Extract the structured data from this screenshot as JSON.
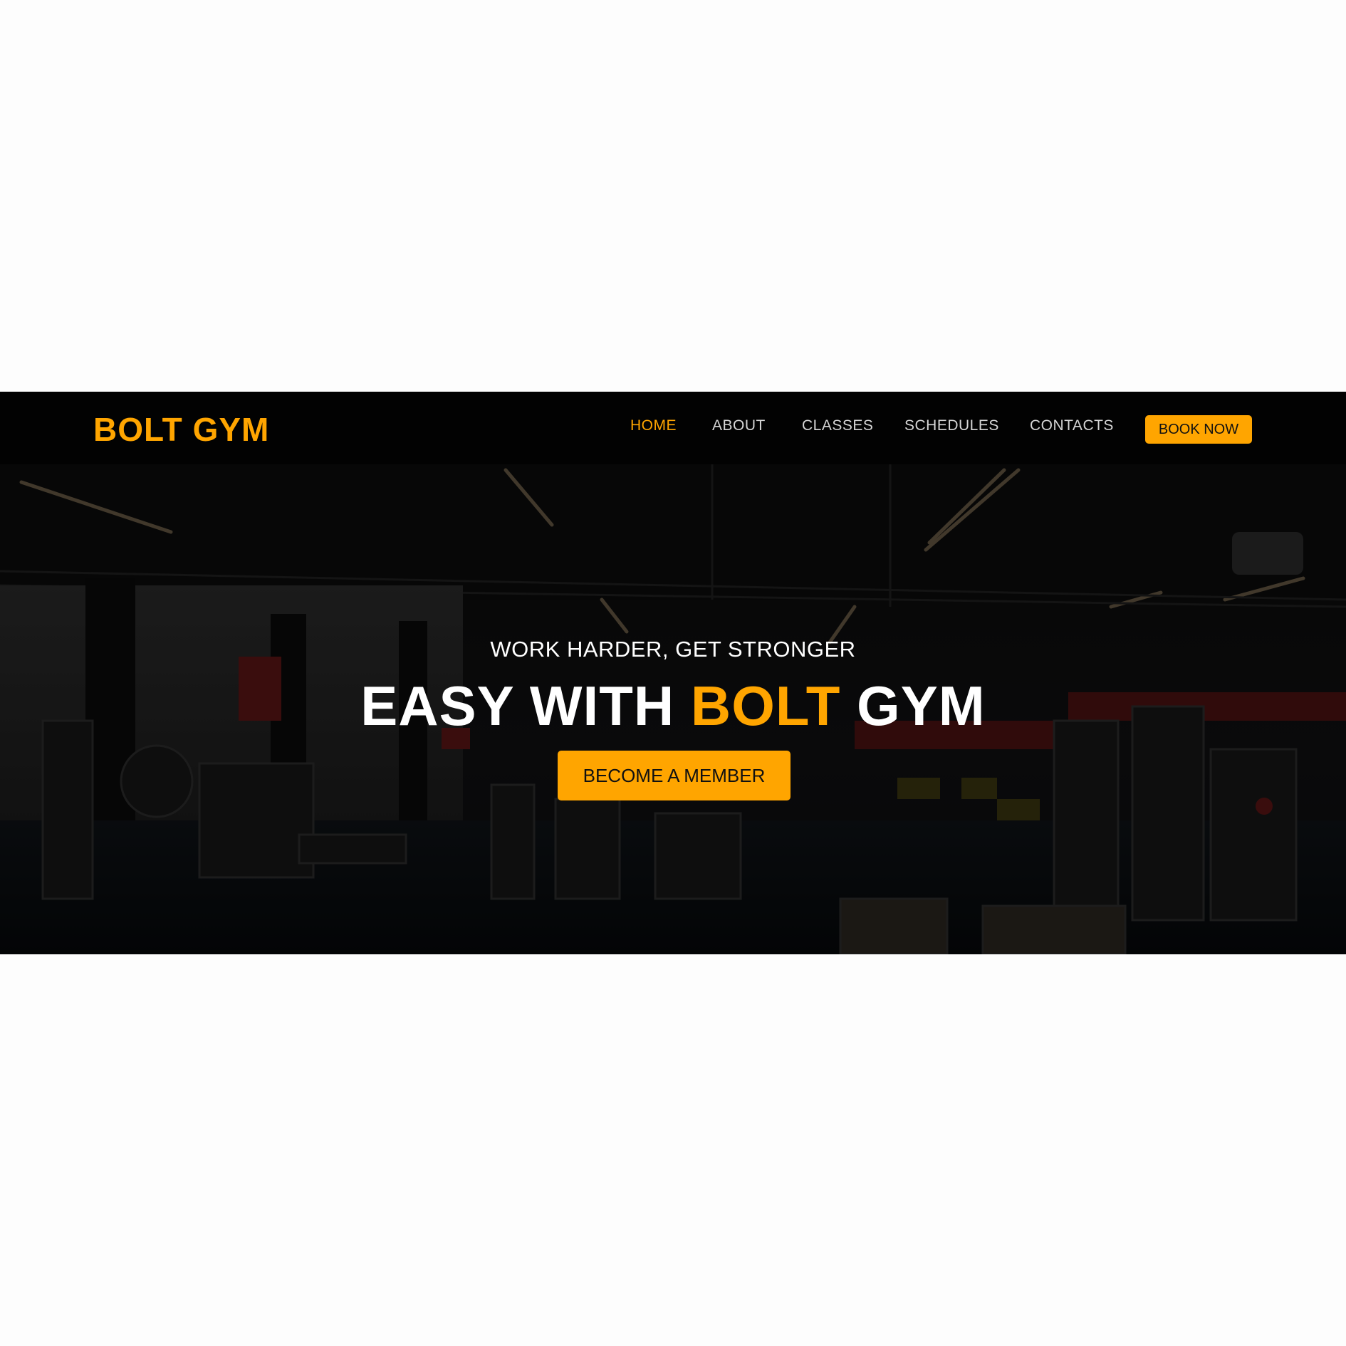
{
  "brand": {
    "name": "BOLT GYM",
    "accent_color": "#ffa500"
  },
  "nav": {
    "items": [
      {
        "label": "HOME",
        "active": true
      },
      {
        "label": "ABOUT",
        "active": false
      },
      {
        "label": "CLASSES",
        "active": false
      },
      {
        "label": "SCHEDULES",
        "active": false
      },
      {
        "label": "CONTACTS",
        "active": false
      }
    ],
    "book_label": "BOOK NOW"
  },
  "hero": {
    "tagline": "WORK HARDER, GET STRONGER",
    "headline_part1": "EASY WITH ",
    "headline_accent": "BOLT",
    "headline_part2": " GYM",
    "cta_label": "BECOME A MEMBER",
    "background_image": "gym-interior-photo"
  }
}
